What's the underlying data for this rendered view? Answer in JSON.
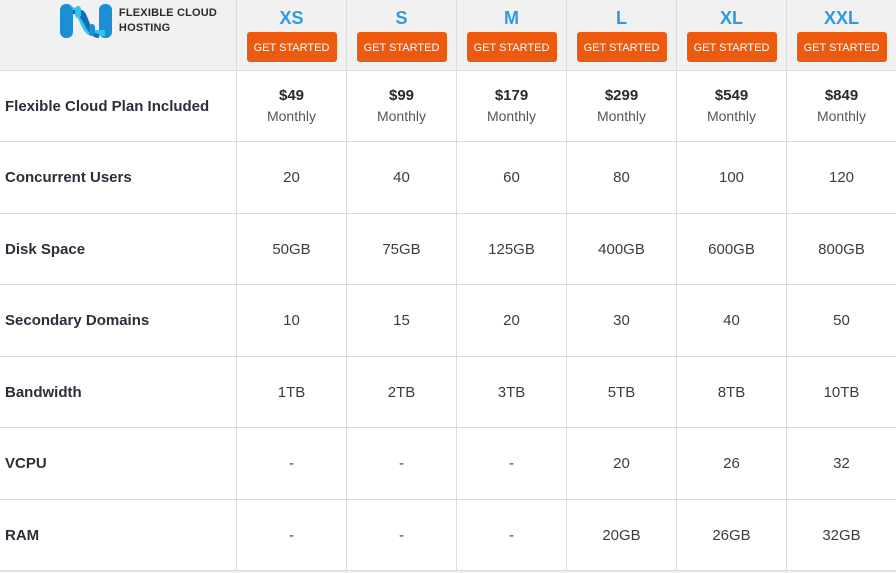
{
  "logo": {
    "line1": "FLEXIBLE CLOUD",
    "line2": "HOSTING",
    "icon": "nh-logo-icon",
    "colors": {
      "primary": "#1a8fd6",
      "light": "#33c2ee"
    }
  },
  "cta_label": "GET STARTED",
  "colors": {
    "accent": "#ec5a10",
    "plan_name": "#2d9be3",
    "header_bg": "#f1f1f1"
  },
  "plans": [
    {
      "name": "XS",
      "price": "$49",
      "period": "Monthly",
      "concurrent_users": "20",
      "disk_space": "50GB",
      "secondary_domains": "10",
      "bandwidth": "1TB",
      "vcpu": "-",
      "ram": "-"
    },
    {
      "name": "S",
      "price": "$99",
      "period": "Monthly",
      "concurrent_users": "40",
      "disk_space": "75GB",
      "secondary_domains": "15",
      "bandwidth": "2TB",
      "vcpu": "-",
      "ram": "-"
    },
    {
      "name": "M",
      "price": "$179",
      "period": "Monthly",
      "concurrent_users": "60",
      "disk_space": "125GB",
      "secondary_domains": "20",
      "bandwidth": "3TB",
      "vcpu": "-",
      "ram": "-"
    },
    {
      "name": "L",
      "price": "$299",
      "period": "Monthly",
      "concurrent_users": "80",
      "disk_space": "400GB",
      "secondary_domains": "30",
      "bandwidth": "5TB",
      "vcpu": "20",
      "ram": "20GB"
    },
    {
      "name": "XL",
      "price": "$549",
      "period": "Monthly",
      "concurrent_users": "100",
      "disk_space": "600GB",
      "secondary_domains": "40",
      "bandwidth": "8TB",
      "vcpu": "26",
      "ram": "26GB"
    },
    {
      "name": "XXL",
      "price": "$849",
      "period": "Monthly",
      "concurrent_users": "120",
      "disk_space": "800GB",
      "secondary_domains": "50",
      "bandwidth": "10TB",
      "vcpu": "32",
      "ram": "32GB"
    }
  ],
  "rows": [
    {
      "key": "price",
      "label": "Flexible Cloud Plan Included"
    },
    {
      "key": "concurrent_users",
      "label": "Concurrent Users"
    },
    {
      "key": "disk_space",
      "label": "Disk Space"
    },
    {
      "key": "secondary_domains",
      "label": "Secondary Domains"
    },
    {
      "key": "bandwidth",
      "label": "Bandwidth"
    },
    {
      "key": "vcpu",
      "label": "VCPU"
    },
    {
      "key": "ram",
      "label": "RAM"
    }
  ]
}
